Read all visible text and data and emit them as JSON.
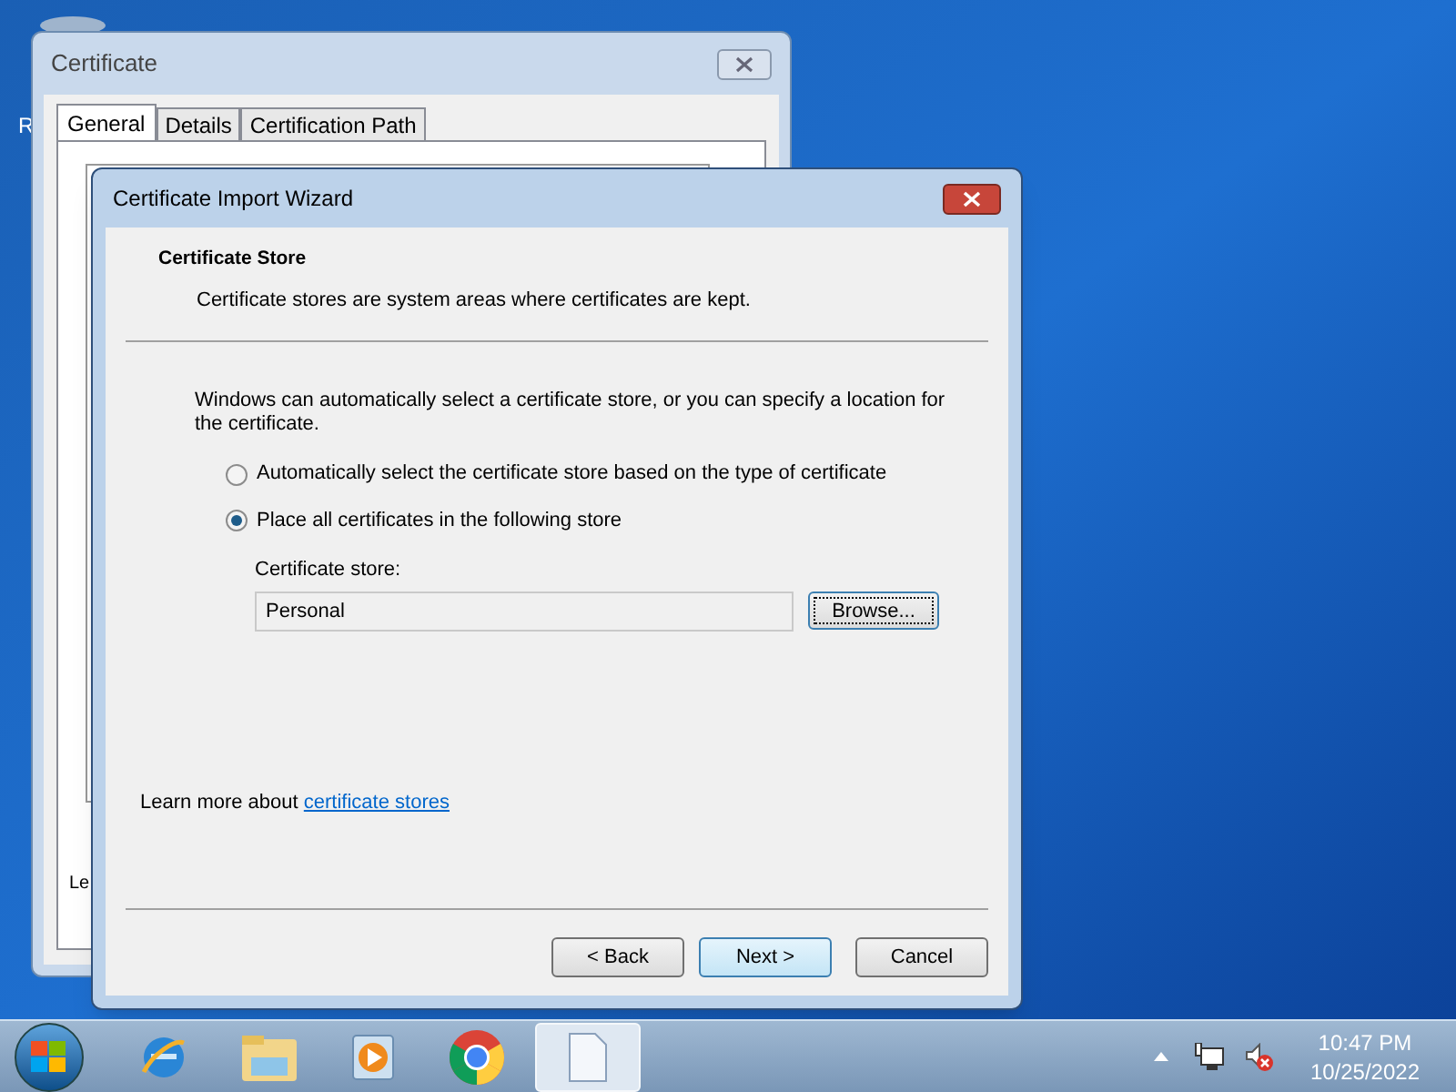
{
  "desktop": {
    "icon_label": "R"
  },
  "background_window": {
    "title": "Certificate",
    "tabs": [
      {
        "label": "General",
        "selected": true
      },
      {
        "label": "Details",
        "selected": false
      },
      {
        "label": "Certification Path",
        "selected": false
      }
    ],
    "partial_text": "Le"
  },
  "wizard": {
    "title": "Certificate Import Wizard",
    "heading": "Certificate Store",
    "subheading": "Certificate stores are system areas where certificates are kept.",
    "intro": "Windows can automatically select a certificate store, or you can specify a location for the certificate.",
    "options": [
      {
        "label": "Automatically select the certificate store based on the type of certificate",
        "selected": false
      },
      {
        "label": "Place all certificates in the following store",
        "selected": true
      }
    ],
    "store_label": "Certificate store:",
    "store_value": "Personal",
    "browse_button": "Browse...",
    "learn_more": "Learn more about",
    "learn_more_link": "certificate stores",
    "buttons": [
      {
        "label": "< Back",
        "focused": false
      },
      {
        "label": "Next >",
        "focused": true
      },
      {
        "label": "Cancel",
        "focused": false
      }
    ]
  },
  "taskbar": {
    "time": "10:47 PM",
    "date": "10/25/2022"
  }
}
